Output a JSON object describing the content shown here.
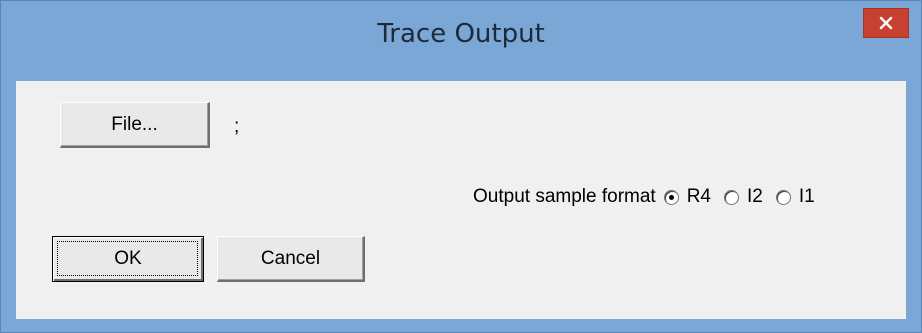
{
  "window": {
    "title": "Trace Output",
    "close_icon": "close-icon",
    "colors": {
      "titlebar": "#7ba7d6",
      "close_button": "#c84031",
      "client_background": "#f0f0f0"
    }
  },
  "file": {
    "button_label": "File...",
    "path_value": ";"
  },
  "output_format": {
    "label": "Output sample format",
    "selected": "R4",
    "options": [
      {
        "label": "R4",
        "checked": true
      },
      {
        "label": "I2",
        "checked": false
      },
      {
        "label": "I1",
        "checked": false
      }
    ]
  },
  "actions": {
    "ok_label": "OK",
    "cancel_label": "Cancel"
  }
}
